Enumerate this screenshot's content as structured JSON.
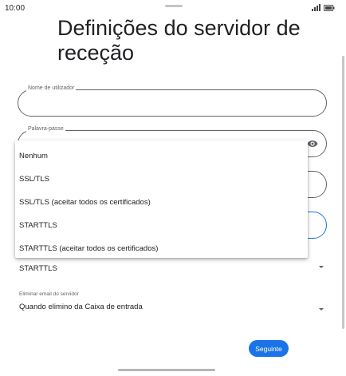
{
  "status_bar": {
    "time": "10:00"
  },
  "page": {
    "title": "Definições do servidor de receção"
  },
  "fields": {
    "username": {
      "label": "Nome de utilizador",
      "value": ""
    },
    "password": {
      "label": "Palavra-passe",
      "value": ""
    }
  },
  "security_menu": {
    "options": [
      "Nenhum",
      "SSL/TLS",
      "SSL/TLS (aceitar todos os certificados)",
      "STARTTLS",
      "STARTTLS (aceitar todos os certificados)"
    ]
  },
  "security_select": {
    "value": "STARTTLS"
  },
  "delete_email": {
    "label": "Eliminar email do servidor",
    "value": "Quando elimino da Caixa de entrada"
  },
  "actions": {
    "next_label": "Seguinte"
  },
  "colors": {
    "accent": "#1a73e8",
    "text": "#202124",
    "secondary_text": "#5f6368"
  }
}
